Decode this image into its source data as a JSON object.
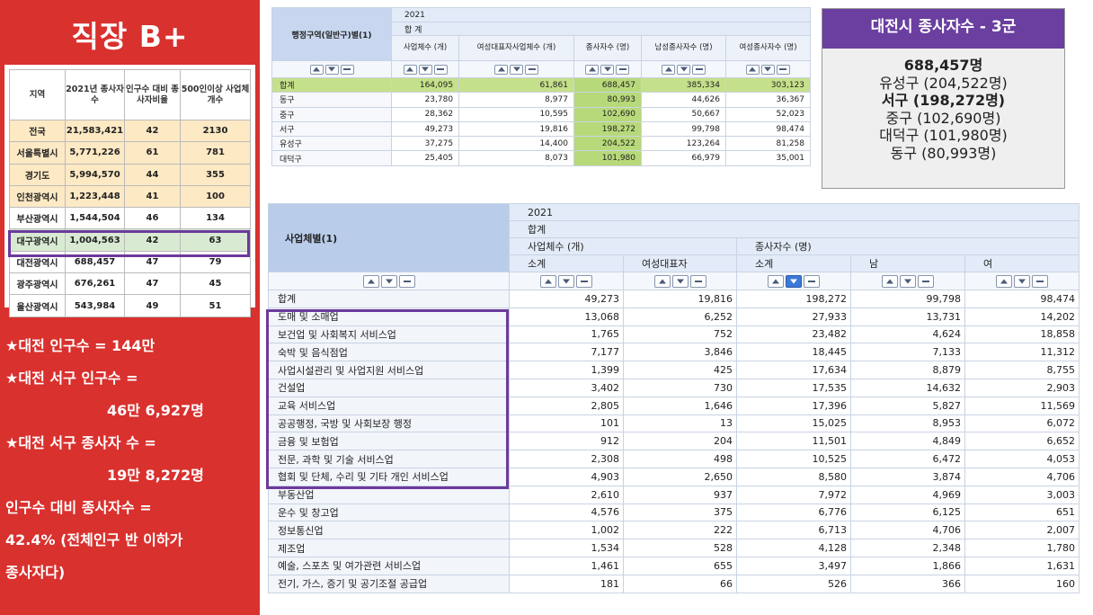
{
  "left": {
    "title": "직장 B+",
    "stat_headers": [
      "지역",
      "2021년 종사자수",
      "인구수 대비 종사자비율",
      "500인이상 사업체개수"
    ],
    "stat_rows": [
      {
        "region": "전국",
        "workers": "21,583,421",
        "ratio": "42",
        "big": "2130",
        "style": "peach"
      },
      {
        "region": "서울특별시",
        "workers": "5,771,226",
        "ratio": "61",
        "big": "781",
        "style": "peach"
      },
      {
        "region": "경기도",
        "workers": "5,994,570",
        "ratio": "44",
        "big": "355",
        "style": "peach"
      },
      {
        "region": "인천광역시",
        "workers": "1,223,448",
        "ratio": "41",
        "big": "100",
        "style": "peach"
      },
      {
        "region": "부산광역시",
        "workers": "1,544,504",
        "ratio": "46",
        "big": "134",
        "style": "plain"
      },
      {
        "region": "대구광역시",
        "workers": "1,004,563",
        "ratio": "42",
        "big": "63",
        "style": "green"
      },
      {
        "region": "대전광역시",
        "workers": "688,457",
        "ratio": "47",
        "big": "79",
        "style": "plain"
      },
      {
        "region": "광주광역시",
        "workers": "676,261",
        "ratio": "47",
        "big": "45",
        "style": "plain"
      },
      {
        "region": "울산광역시",
        "workers": "543,984",
        "ratio": "49",
        "big": "51",
        "style": "plain"
      }
    ],
    "notes": {
      "l1": "★대전 인구수 = 144만",
      "l2": "★대전 서구 인구수 =",
      "l3": "46만 6,927명",
      "l4": "★대전 서구 종사자 수 =",
      "l5": "19만 8,272명",
      "l6": "인구수 대비 종사자수 =",
      "l7": "42.4% (전체인구 반 이하가",
      "l8": "종사자다)"
    }
  },
  "top_table": {
    "stub": "행정구역(일반구)별(1)",
    "year": "2021",
    "sub": "합 계",
    "columns": [
      "사업체수 (개)",
      "여성대표자사업체수 (개)",
      "종사자수 (명)",
      "남성종사자수 (명)",
      "여성종사자수 (명)"
    ],
    "rows": [
      {
        "label": "합계",
        "values": [
          "164,095",
          "61,861",
          "688,457",
          "385,334",
          "303,123"
        ]
      },
      {
        "label": "동구",
        "values": [
          "23,780",
          "8,977",
          "80,993",
          "44,626",
          "36,367"
        ]
      },
      {
        "label": "중구",
        "values": [
          "28,362",
          "10,595",
          "102,690",
          "50,667",
          "52,023"
        ]
      },
      {
        "label": "서구",
        "values": [
          "49,273",
          "19,816",
          "198,272",
          "99,798",
          "98,474"
        ]
      },
      {
        "label": "유성구",
        "values": [
          "37,275",
          "14,400",
          "204,522",
          "123,264",
          "81,258"
        ]
      },
      {
        "label": "대덕구",
        "values": [
          "25,405",
          "8,073",
          "101,980",
          "66,979",
          "35,001"
        ]
      }
    ]
  },
  "summary": {
    "title": "대전시 종사자수 - 3군",
    "lines": [
      "688,457명",
      "유성구 (204,522명)",
      "서구 (198,272명)",
      "중구 (102,690명)",
      "대덕구 (101,980명)",
      "동구 (80,993명)"
    ]
  },
  "main_table": {
    "stub": "사업체별(1)",
    "year": "2021",
    "sub": "합계",
    "group1": "사업체수 (개)",
    "group2": "종사자수 (명)",
    "cols": [
      "소계",
      "여성대표자",
      "소계",
      "남",
      "여"
    ],
    "rows": [
      {
        "label": "합계",
        "values": [
          "49,273",
          "19,816",
          "198,272",
          "99,798",
          "98,474"
        ]
      },
      {
        "label": "도매 및 소매업",
        "values": [
          "13,068",
          "6,252",
          "27,933",
          "13,731",
          "14,202"
        ]
      },
      {
        "label": "보건업 및 사회복지 서비스업",
        "values": [
          "1,765",
          "752",
          "23,482",
          "4,624",
          "18,858"
        ]
      },
      {
        "label": "숙박 및 음식점업",
        "values": [
          "7,177",
          "3,846",
          "18,445",
          "7,133",
          "11,312"
        ]
      },
      {
        "label": "사업시설관리 및 사업지원 서비스업",
        "values": [
          "1,399",
          "425",
          "17,634",
          "8,879",
          "8,755"
        ]
      },
      {
        "label": "건설업",
        "values": [
          "3,402",
          "730",
          "17,535",
          "14,632",
          "2,903"
        ]
      },
      {
        "label": "교육 서비스업",
        "values": [
          "2,805",
          "1,646",
          "17,396",
          "5,827",
          "11,569"
        ]
      },
      {
        "label": "공공행정, 국방 및 사회보장 행정",
        "values": [
          "101",
          "13",
          "15,025",
          "8,953",
          "6,072"
        ]
      },
      {
        "label": "금융 및 보험업",
        "values": [
          "912",
          "204",
          "11,501",
          "4,849",
          "6,652"
        ]
      },
      {
        "label": "전문, 과학 및 기술 서비스업",
        "values": [
          "2,308",
          "498",
          "10,525",
          "6,472",
          "4,053"
        ]
      },
      {
        "label": "협회 및 단체, 수리 및 기타 개인 서비스업",
        "values": [
          "4,903",
          "2,650",
          "8,580",
          "3,874",
          "4,706"
        ]
      },
      {
        "label": "부동산업",
        "values": [
          "2,610",
          "937",
          "7,972",
          "4,969",
          "3,003"
        ]
      },
      {
        "label": "운수 및 창고업",
        "values": [
          "4,576",
          "375",
          "6,776",
          "6,125",
          "651"
        ]
      },
      {
        "label": "정보통신업",
        "values": [
          "1,002",
          "222",
          "6,713",
          "4,706",
          "2,007"
        ]
      },
      {
        "label": "제조업",
        "values": [
          "1,534",
          "528",
          "4,128",
          "2,348",
          "1,780"
        ]
      },
      {
        "label": "예술, 스포츠 및 여가관련 서비스업",
        "values": [
          "1,461",
          "655",
          "3,497",
          "1,866",
          "1,631"
        ]
      },
      {
        "label": "전기, 가스, 증기 및 공기조절 공급업",
        "values": [
          "181",
          "66",
          "526",
          "366",
          "160"
        ]
      }
    ]
  },
  "colors": {
    "red": "#d9312e",
    "purple": "#6a3fa0",
    "green": "#b8d97a",
    "header_blue": "#b9cdea"
  }
}
